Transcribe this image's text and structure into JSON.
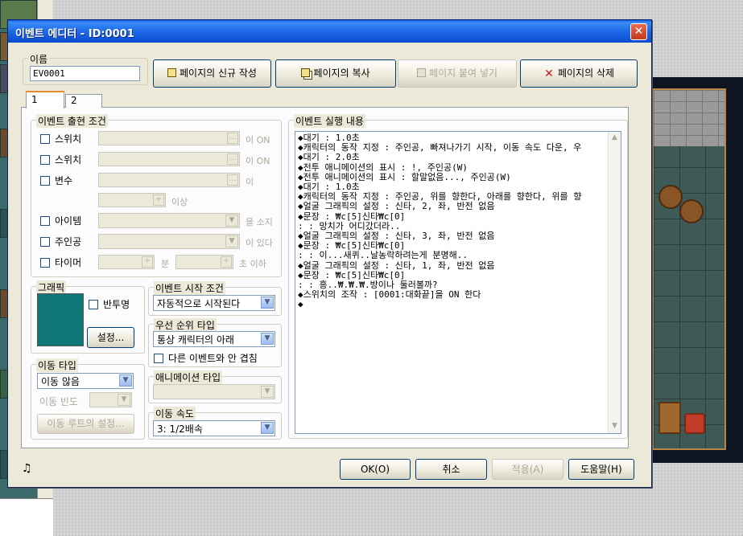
{
  "window": {
    "title": "이벤트 에디터 - ID:0001",
    "close_glyph": "✕"
  },
  "name_group": {
    "label": "이름",
    "value": "EV0001"
  },
  "page_buttons": {
    "new_page": "페이지의 신규 작성",
    "copy_page": "페이지의 복사",
    "paste_page": "페이지 붙여 넣기",
    "delete_page": "페이지의 삭제"
  },
  "tabs": [
    "1",
    "2"
  ],
  "conditions": {
    "label": "이벤트 출현 조건",
    "switch1": "스위치",
    "switch1_suffix": "이 ON",
    "switch2": "스위치",
    "switch2_suffix": "이 ON",
    "variable": "변수",
    "variable_suffix": "이",
    "variable_suffix2": "이상",
    "item": "아이템",
    "item_suffix": "을 소지",
    "actor": "주인공",
    "actor_suffix": "이 있다",
    "timer": "타이머",
    "timer_min": "분",
    "timer_suffix": "초 이하"
  },
  "graphic": {
    "label": "그래픽",
    "transparent": "반투명",
    "settings_button": "설정..."
  },
  "start_condition": {
    "label": "이벤트 시작 조건",
    "value": "자동적으로 시작된다"
  },
  "priority": {
    "label": "우선 순위 타입",
    "value": "통상 캐릭터의 아래",
    "overlap": "다른 이벤트와 안 겹침"
  },
  "animation": {
    "label": "애니메이션 타입",
    "value": ""
  },
  "movement": {
    "label": "이동 타입",
    "value": "이동 않음",
    "frequency_label": "이동 빈도",
    "route_button": "이동 루트의 설정..."
  },
  "speed": {
    "label": "이동 속도",
    "value": "3: 1/2배속"
  },
  "exec": {
    "label": "이벤트 실행 내용",
    "lines": [
      "◆대기 : 1.0초",
      "◆캐릭터의 동작 지정 : 주인공, 빠져나가기 시작, 이동 속도 다운, 우",
      "◆대기 : 2.0초",
      "◆전투 애니메이션의 표시 : !, 주인공(W)",
      "◆전투 애니메이션의 표시 : 할말없음..., 주인공(W)",
      "◆대기 : 1.0초",
      "◆캐릭터의 동작 지정 : 주인공, 위를 향한다, 아래를 향한다, 위를 향",
      "◆얼굴 그래픽의 설정 : 신타, 2, 좌, 반전 없음",
      "◆문장 : ₩c[5]신타₩c[0]",
      " :    : 망치가 어디갔더라..",
      "◆얼굴 그래픽의 설정 : 신타, 3, 좌, 반전 없음",
      "◆문장 : ₩c[5]신타₩c[0]",
      " :    : 이...새퀴..날농락하려는게 분명해..",
      "◆얼굴 그래픽의 설정 : 신타, 1, 좌, 반전 없음",
      "◆문장 : ₩c[5]신타₩c[0]",
      " :    : 흥..₩.₩.₩.방이나 둘러볼까?",
      "◆스위치의 조작 : [0001:대화끝]을 ON 한다",
      "◆"
    ]
  },
  "bottom": {
    "music_icon": "♫",
    "ok": "OK(O)",
    "cancel": "취소",
    "apply": "적용(A)",
    "help": "도움말(H)"
  },
  "icons": {
    "new": "new-page-icon",
    "copy": "copy-icon",
    "paste": "paste-icon",
    "delete": "delete-icon"
  }
}
